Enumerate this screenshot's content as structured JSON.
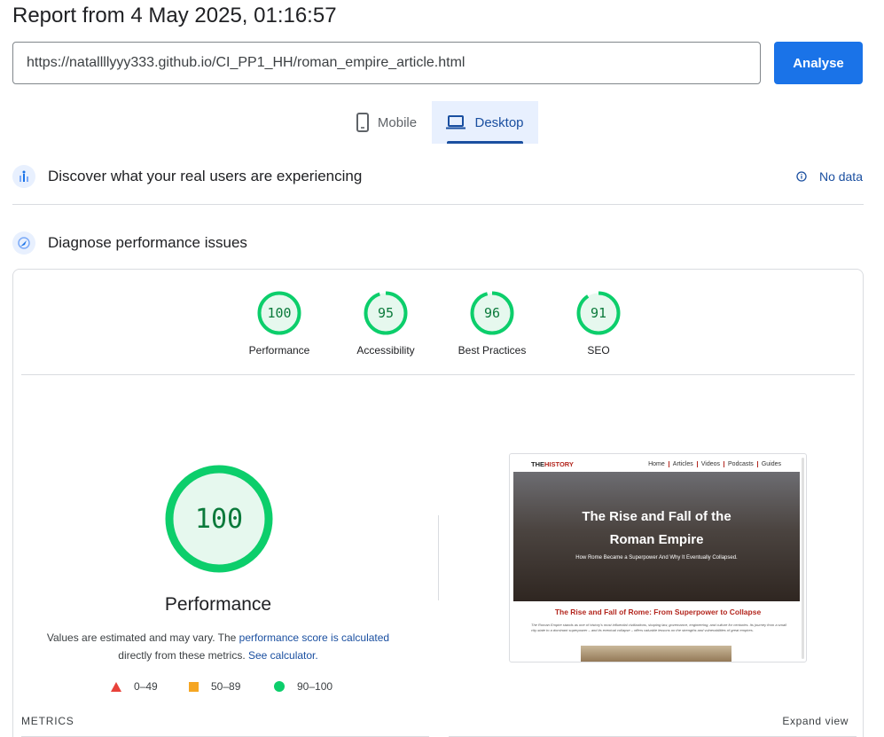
{
  "report": {
    "title": "Report from 4 May 2025, 01:16:57"
  },
  "search": {
    "url": "https://natallllyyy333.github.io/CI_PP1_HH/roman_empire_article.html",
    "analyse_label": "Analyse"
  },
  "tabs": [
    {
      "label": "Mobile",
      "icon": "phone-icon",
      "selected": false
    },
    {
      "label": "Desktop",
      "icon": "laptop-icon",
      "selected": true
    }
  ],
  "real_users": {
    "title": "Discover what your real users are experiencing",
    "status": "No data",
    "icon": "users-chart-icon"
  },
  "diagnose": {
    "title": "Diagnose performance issues",
    "icon": "lighthouse-icon"
  },
  "scores": [
    {
      "label": "Performance",
      "value": "100",
      "fraction": 1.0
    },
    {
      "label": "Accessibility",
      "value": "95",
      "fraction": 0.95
    },
    {
      "label": "Best Practices",
      "value": "96",
      "fraction": 0.96
    },
    {
      "label": "SEO",
      "value": "91",
      "fraction": 0.91
    }
  ],
  "main_score": {
    "value": "100",
    "fraction": 1.0,
    "title": "Performance",
    "note_prefix": "Values are estimated and may vary. The ",
    "note_link1": "performance score is calculated",
    "note_mid": " directly from these metrics.",
    "note_link2": "See calculator."
  },
  "legend": [
    {
      "range": "0–49",
      "shape": "triangle",
      "color": "#e8423a"
    },
    {
      "range": "50–89",
      "shape": "square",
      "color": "#f5a623"
    },
    {
      "range": "90–100",
      "shape": "circle",
      "color": "#0cce6b"
    }
  ],
  "screenshot": {
    "logo_prefix": "THE",
    "logo_accent": "HISTORY",
    "nav": [
      "Home",
      "Articles",
      "Videos",
      "Podcasts",
      "Guides"
    ],
    "hero_title_line1": "The Rise and Fall of the",
    "hero_title_line2": "Roman Empire",
    "hero_subtitle": "How Rome Became a Superpower And Why It Eventually Collapsed.",
    "heading": "The Rise and Fall of Rome: From Superpower to Collapse",
    "body": "The Roman Empire stands as one of history's most influential civilizations, shaping law, governance, engineering, and culture for centuries. Its journey from a small city-state to a dominant superpower – and its eventual collapse – offers valuable lessons on the strengths and vulnerabilities of great empires."
  },
  "metrics": {
    "label": "METRICS",
    "expand": "Expand view"
  },
  "colors": {
    "pass": "#0cce6b",
    "pass_text": "#0b7a3b",
    "pass_bg": "#e6f8ee",
    "accent": "#1a73e8"
  }
}
